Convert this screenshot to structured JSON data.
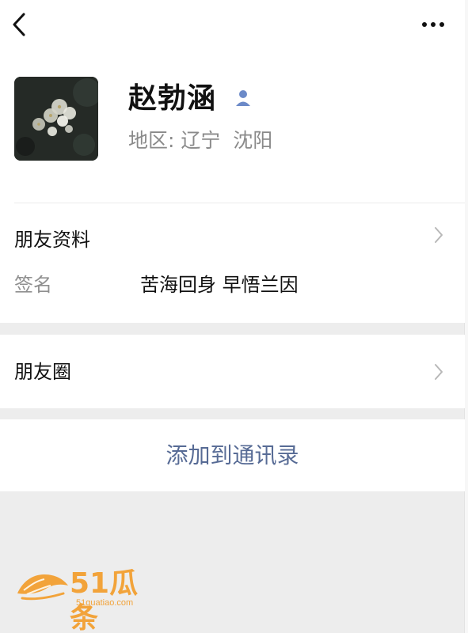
{
  "topbar": {
    "back_icon": "back-arrow-icon",
    "more_icon": "more-dots-icon"
  },
  "profile": {
    "name": "赵勃涵",
    "region": "地区: 辽宁  沈阳",
    "avatar_desc": "flower-photo",
    "contact_icon": "person-icon"
  },
  "friend_info": {
    "title": "朋友资料",
    "signature_label": "签名",
    "signature_value": "苦海回身 早悟兰因"
  },
  "moments": {
    "label": "朋友圈"
  },
  "actions": {
    "add_to_contacts": "添加到通讯录"
  },
  "watermark": {
    "text": "51瓜条",
    "subtext": "51guatiao.com"
  },
  "colors": {
    "link_blue": "#576b95",
    "background_gray": "#ededed",
    "watermark_orange": "#f2a33a"
  }
}
